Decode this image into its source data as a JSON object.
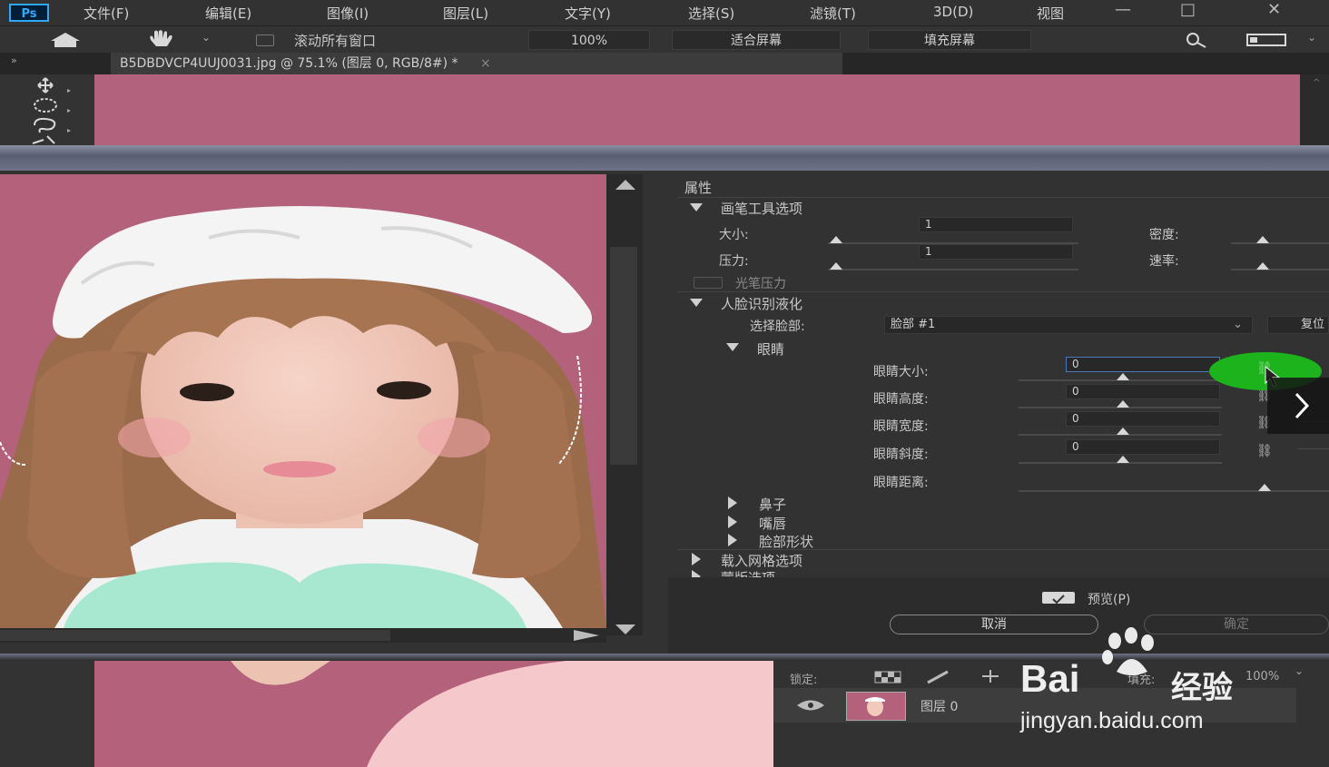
{
  "app": {
    "logo_text": "Ps"
  },
  "menu": [
    "文件(F)",
    "编辑(E)",
    "图像(I)",
    "图层(L)",
    "文字(Y)",
    "选择(S)",
    "滤镜(T)",
    "3D(D)",
    "视图"
  ],
  "window_controls": [
    "—",
    "□",
    "✕"
  ],
  "options_bar": {
    "scroll_all_label": "滚动所有窗口",
    "zoom_value": "100%",
    "fit_screen_label": "适合屏幕",
    "fill_screen_label": "填充屏幕"
  },
  "document_tab": {
    "title": "B5DBDVCP4UUJ0031.jpg @ 75.1% (图层 0, RGB/8#) *",
    "close": "×"
  },
  "properties": {
    "panel_title": "属性",
    "brush_section": "画笔工具选项",
    "size_label": "大小:",
    "size_value": "1",
    "density_label": "密度:",
    "pressure_label": "压力:",
    "pressure_value": "1",
    "rate_label": "速率:",
    "stylus_label": "光笔压力",
    "face_section": "人脸识别液化",
    "select_face_label": "选择脸部:",
    "select_face_value": "脸部 #1",
    "reset_label": "复位",
    "eyes_section": "眼睛",
    "eye_rows": [
      {
        "label": "眼睛大小:",
        "value": "0"
      },
      {
        "label": "眼睛高度:",
        "value": "0"
      },
      {
        "label": "眼睛宽度:",
        "value": "0"
      },
      {
        "label": "眼睛斜度:",
        "value": "0"
      }
    ],
    "eye_distance_label": "眼睛距离:",
    "nose_section": "鼻子",
    "mouth_section": "嘴唇",
    "face_shape_section": "脸部形状",
    "load_mesh_section": "载入网格选项",
    "mask_section": "蒙版选项",
    "preview_label": "预览(P)",
    "cancel_label": "取消",
    "ok_label": "确定"
  },
  "layers": {
    "lock_label": "锁定:",
    "fill_label": "填充:",
    "fill_value": "100%",
    "layer_name": "图层 0"
  },
  "watermark": {
    "brand": "Bai",
    "brand2": "经验",
    "url": "jingyan.baidu.com"
  },
  "colors": {
    "canvas_pink": "#b4617c",
    "ps_blue": "#31a8ff",
    "cursor_highlight": "#1db31d"
  }
}
